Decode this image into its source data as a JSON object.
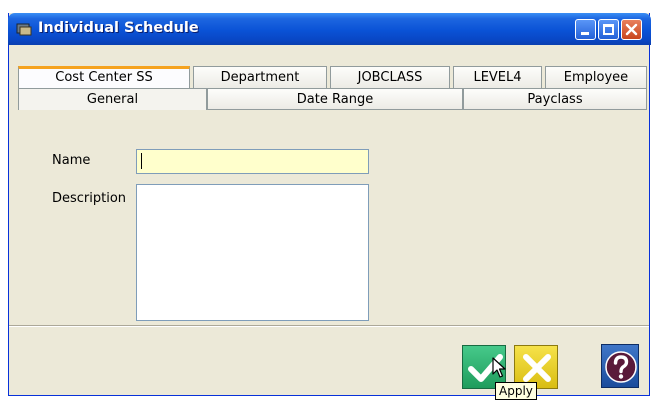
{
  "window": {
    "title": "Individual Schedule"
  },
  "tabs": {
    "row1": [
      "Cost Center SS",
      "Department",
      "JOBCLASS",
      "LEVEL4",
      "Employee"
    ],
    "row2": [
      "General",
      "Date Range",
      "Payclass"
    ],
    "selected": "General"
  },
  "form": {
    "name_label": "Name",
    "name_value": "",
    "description_label": "Description",
    "description_value": ""
  },
  "buttons": {
    "apply_tooltip": "Apply"
  },
  "colors": {
    "title_bar": "#0a52d6",
    "active_tab_accent": "#f5a31f",
    "name_field_bg": "#ffffcc",
    "apply": "#2db06e",
    "cancel": "#f0d62a",
    "help": "#2a5fb0"
  },
  "icons": {
    "app": "schedule-app-icon",
    "minimize": "minimize-icon",
    "maximize": "maximize-icon",
    "close": "close-icon",
    "apply": "checkmark-icon",
    "cancel": "x-icon",
    "help": "question-icon",
    "cursor": "mouse-pointer-icon"
  }
}
